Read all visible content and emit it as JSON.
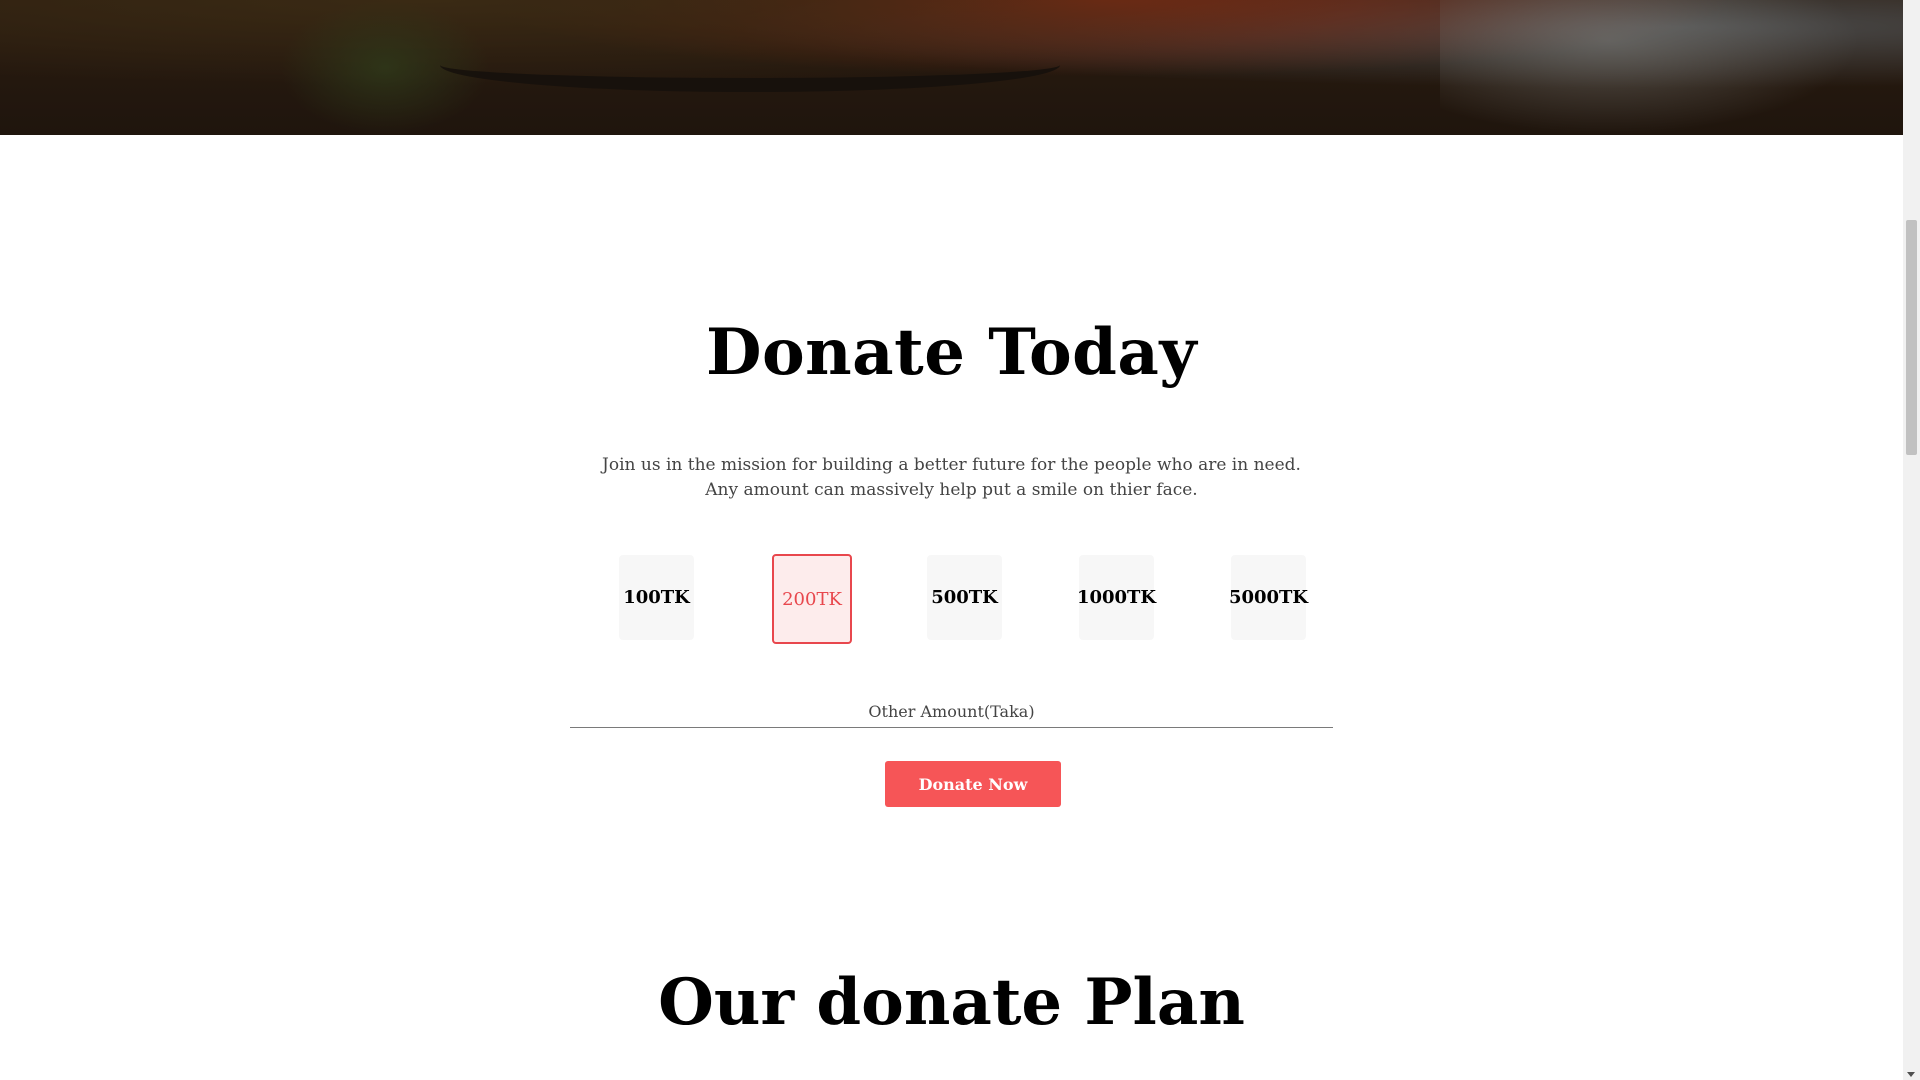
{
  "donate": {
    "title": "Donate Today",
    "intro_line1": "Join us in the mission for building a better future for the people who are in need.",
    "intro_line2": "Any amount can massively help put a smile on thier face.",
    "amounts": [
      "100TK",
      "200TK",
      "500TK",
      "1000TK",
      "5000TK"
    ],
    "selected_amount": "200TK",
    "other_amount_label": "Other Amount(Taka)",
    "other_amount_value": "",
    "button_label": "Donate Now"
  },
  "plan": {
    "title": "Our donate Plan"
  },
  "colors": {
    "accent": "#f65557",
    "selected_border": "#e8474d",
    "selected_bg": "#fdecec",
    "tile_bg": "#f7f7f7"
  }
}
